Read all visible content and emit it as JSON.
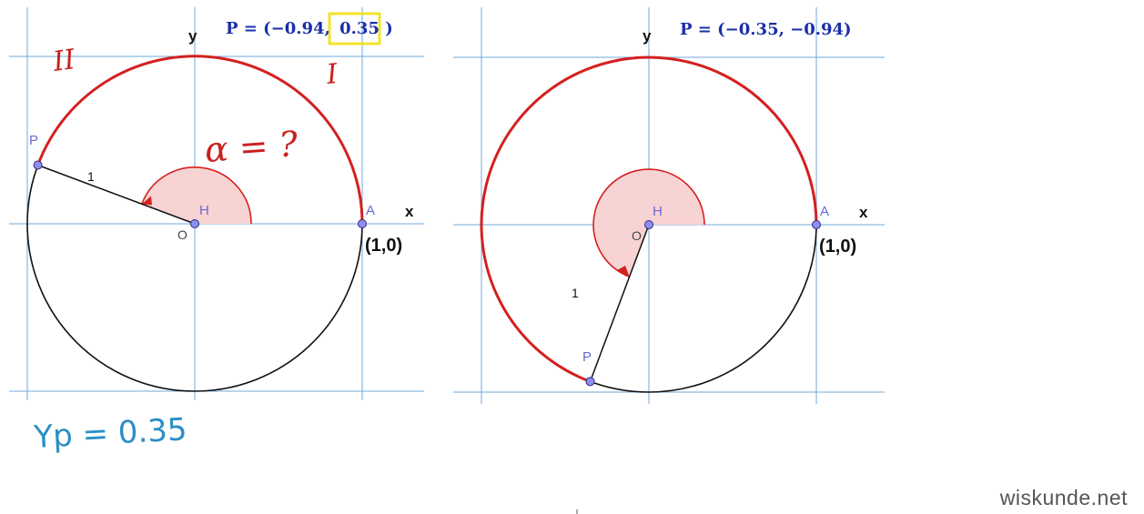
{
  "diagrams": [
    {
      "title": "P = (−0.94, 0.35)",
      "title_parts": {
        "prefix": "P = (−0.94,",
        "highlight": "0.35",
        "suffix": ")"
      },
      "point_P": {
        "x": -0.94,
        "y": 0.35
      },
      "axis_x": "x",
      "axis_y": "y",
      "label_P": "P",
      "label_A": "A",
      "label_H": "H",
      "label_O": "O",
      "radius_label": "1",
      "unit_point": "(1,0)",
      "quadrant_left": "II",
      "quadrant_right": "I",
      "angle_note": "α = ?",
      "yp_note": "Yp = 0.35"
    },
    {
      "title": "P = (−0.35, −0.94)",
      "point_P": {
        "x": -0.35,
        "y": -0.94
      },
      "axis_x": "x",
      "axis_y": "y",
      "label_P": "P",
      "label_A": "A",
      "label_H": "H",
      "label_O": "O",
      "radius_label": "1",
      "unit_point": "(1,0)"
    }
  ],
  "watermark": "wiskunde.net",
  "colors": {
    "grid": "#6fa8dc",
    "arc": "#d42020",
    "sector_fill": "#f8d3d3",
    "point": "#8e8ef0",
    "title": "#1a2fa8",
    "highlight_box": "#f2e32c",
    "handwriting_blue": "#2a8fc4"
  }
}
